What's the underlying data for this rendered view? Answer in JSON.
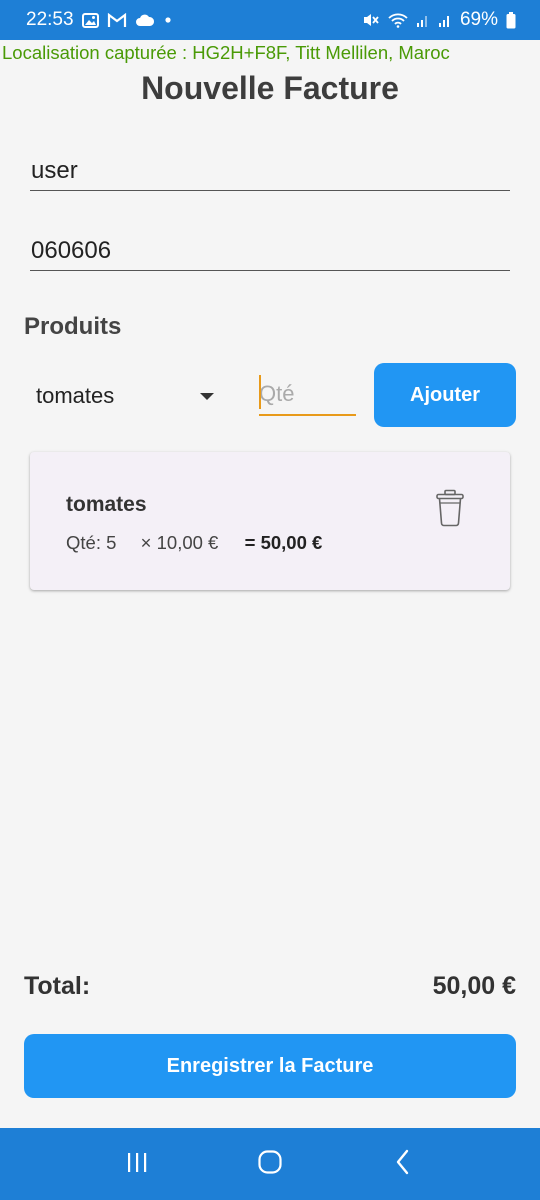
{
  "status_bar": {
    "time": "22:53",
    "battery": "69%",
    "icons_left": [
      "gallery-icon",
      "gmail-icon",
      "cloud-icon",
      "dot-icon"
    ],
    "icons_right": [
      "mute-icon",
      "wifi-icon",
      "signal-icon",
      "signal-icon",
      "battery-icon"
    ],
    "background": "#1e7fd6"
  },
  "location": {
    "text": "Localisation capturée : HG2H+F8F, Titt Mellilen, Maroc",
    "color": "#4a9a06"
  },
  "page": {
    "title": "Nouvelle Facture"
  },
  "form": {
    "username_value": "user",
    "phone_value": "060606"
  },
  "products": {
    "section_title": "Produits",
    "selected_product": "tomates",
    "qty_placeholder": "Qté",
    "add_label": "Ajouter"
  },
  "items": [
    {
      "name": "tomates",
      "qty_text": "Qté: 5",
      "unit_price_text": "× 10,00 €",
      "total_text": "= 50,00 €"
    }
  ],
  "summary": {
    "total_label": "Total:",
    "total_value": "50,00 €",
    "save_label": "Enregistrer la Facture"
  },
  "nav": {
    "buttons": [
      "recents-icon",
      "home-icon",
      "back-icon"
    ]
  },
  "colors": {
    "accent": "#2196f3",
    "focus": "#e89a1a",
    "system_bar": "#1e7fd6"
  }
}
